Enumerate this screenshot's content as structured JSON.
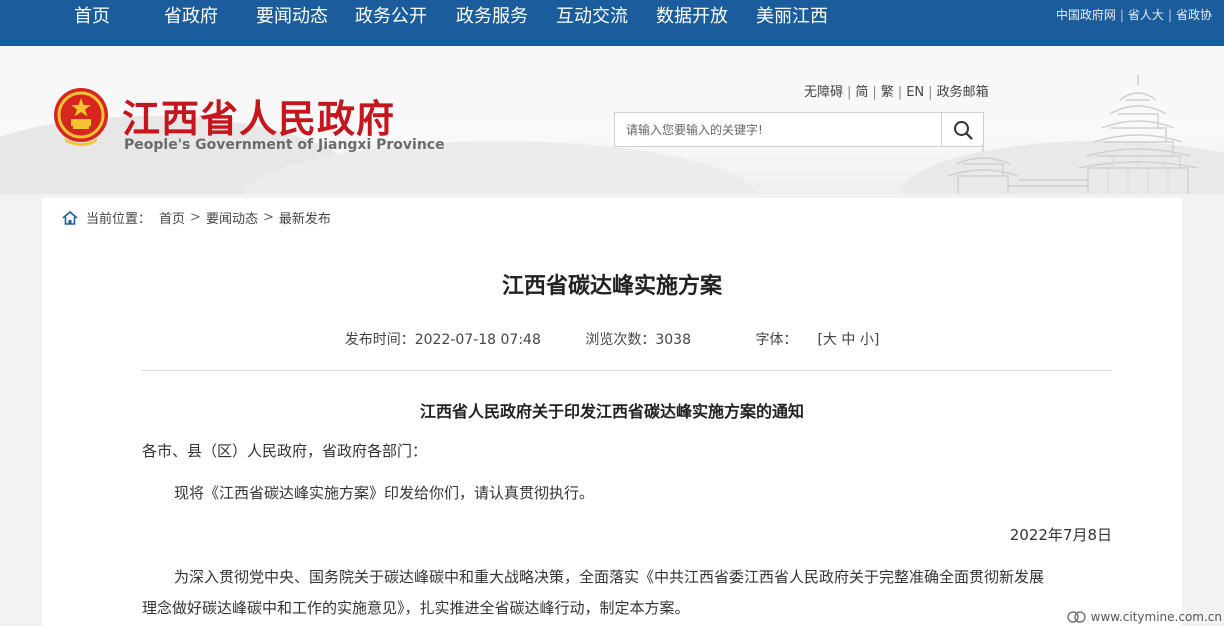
{
  "nav": {
    "items": [
      "首页",
      "省政府",
      "要闻动态",
      "政务公开",
      "政务服务",
      "互动交流",
      "数据开放",
      "美丽江西"
    ],
    "top_links": [
      "中国政府网",
      "省人大",
      "省政协"
    ]
  },
  "header": {
    "title": "江西省人民政府",
    "subtitle": "People's Government of Jiangxi Province",
    "util_links": [
      "无障碍",
      "简",
      "繁",
      "EN",
      "政务邮箱"
    ],
    "search_placeholder": "请输入您要输入的关键字!"
  },
  "breadcrumb": {
    "label": "当前位置：",
    "items": [
      "首页",
      "要闻动态",
      "最新发布"
    ]
  },
  "article": {
    "title": "江西省碳达峰实施方案",
    "publish_time": "发布时间：2022-07-18 07:48",
    "views": "浏览次数：3038",
    "font_label": "字体：",
    "font_sizes": [
      "大",
      "中",
      "小"
    ],
    "notice_title": "江西省人民政府关于印发江西省碳达峰实施方案的通知",
    "addressee": "各市、县（区）人民政府，省政府各部门：",
    "para1": "现将《江西省碳达峰实施方案》印发给你们，请认真贯彻执行。",
    "date": "2022年7月8日",
    "body_line1": "为深入贯彻党中央、国务院关于碳达峰碳中和重大战略决策，全面落实《中共江西省委江西省人民政府关于完整准确全面贯彻新发展",
    "body_line2": "理念做好碳达峰碳中和工作的实施意见》，扎实推进全省碳达峰行动，制定本方案。"
  },
  "watermark": "www.citymine.com.cn",
  "colors": {
    "nav_bg": "#1b5d9c",
    "title_red": "#c4161c"
  }
}
